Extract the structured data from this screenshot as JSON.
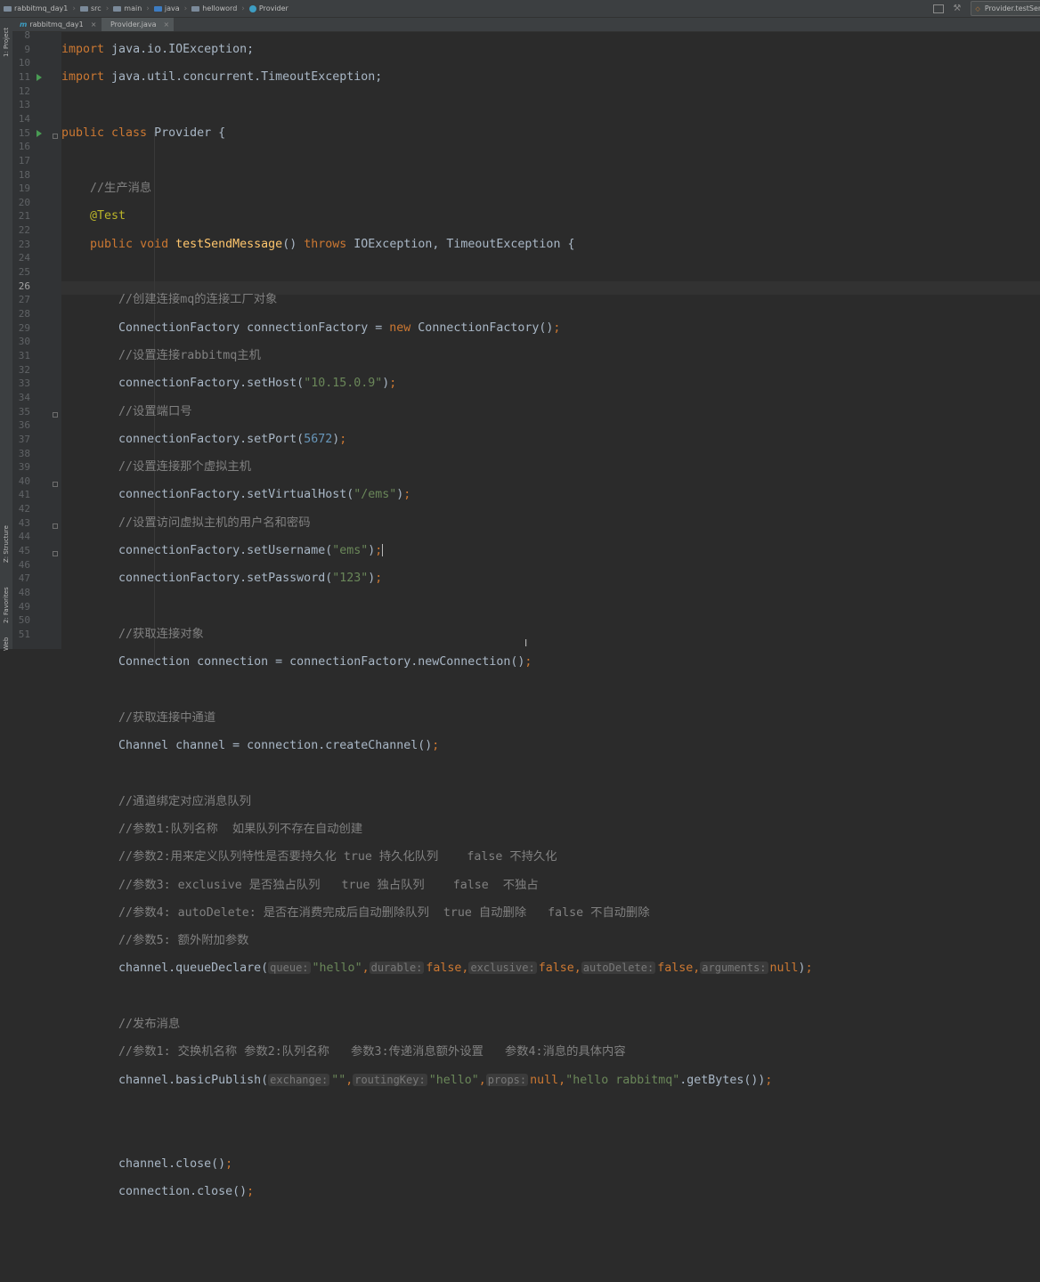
{
  "breadcrumbs": [
    "rabbitmq_day1",
    "src",
    "main",
    "java",
    "helloword",
    "Provider"
  ],
  "run_config": "Provider.testSen",
  "tabs": [
    {
      "label": "rabbitmq_day1",
      "active": false
    },
    {
      "label": "Provider.java",
      "active": true
    }
  ],
  "side_tabs": [
    "1: Project",
    "Z: Structure",
    "2: Favorites",
    "Web"
  ],
  "editor": {
    "current_line": 26,
    "line_numbers": [
      "8",
      "9",
      "10",
      "11",
      "12",
      "13",
      "14",
      "15",
      "16",
      "17",
      "18",
      "19",
      "20",
      "21",
      "22",
      "23",
      "24",
      "25",
      "26",
      "27",
      "28",
      "29",
      "30",
      "31",
      "32",
      "33",
      "34",
      "35",
      "36",
      "37",
      "38",
      "39",
      "40",
      "41",
      "42",
      "43",
      "44",
      "45",
      "46",
      "47",
      "48",
      "49",
      "50",
      "51"
    ],
    "code": {
      "l8_kw": "import",
      "l8_rest": " java.io.IOException;",
      "l9_kw": "import",
      "l9_rest": " java.util.concurrent.TimeoutException;",
      "l11_kw": "public class",
      "l11_rest": " Provider {",
      "l13": "//生产消息",
      "l14": "@Test",
      "l15_kw": "public void",
      "l15_fn": "testSendMessage",
      "l15_mid": "() ",
      "l15_throws": "throws",
      "l15_rest": " IOException, TimeoutException {",
      "l17": "//创建连接mq的连接工厂对象",
      "l18_a": "ConnectionFactory connectionFactory = ",
      "l18_new": "new",
      "l18_b": " ConnectionFactory()",
      "l19": "//设置连接rabbitmq主机",
      "l20_a": "connectionFactory.setHost(",
      "l20_s": "\"10.15.0.9\"",
      "l21": "//设置端口号",
      "l22_a": "connectionFactory.setPort(",
      "l22_n": "5672",
      "l23": "//设置连接那个虚拟主机",
      "l24_a": "connectionFactory.setVirtualHost(",
      "l24_s": "\"/ems\"",
      "l25": "//设置访问虚拟主机的用户名和密码",
      "l26_a": "connectionFactory.setUsername(",
      "l26_s": "\"ems\"",
      "l27_a": "connectionFactory.setPassword(",
      "l27_s": "\"123\"",
      "l29": "//获取连接对象",
      "l30": "Connection connection = connectionFactory.newConnection()",
      "l32": "//获取连接中通道",
      "l33": "Channel channel = connection.createChannel()",
      "l35": "//通道绑定对应消息队列",
      "l36": "//参数1:队列名称  如果队列不存在自动创建",
      "l37": "//参数2:用来定义队列特性是否要持久化 true 持久化队列    false 不持久化",
      "l38": "//参数3: exclusive 是否独占队列   true 独占队列    false  不独占",
      "l39": "//参数4: autoDelete: 是否在消费完成后自动删除队列  true 自动删除   false 不自动删除",
      "l40": "//参数5: 额外附加参数",
      "l41_a": "channel.queueDeclare(",
      "l41_h1": "queue:",
      "l41_s1": "\"hello\"",
      "l41_h2": "durable:",
      "l41_k2": "false",
      "l41_h3": "exclusive:",
      "l41_k3": "false",
      "l41_h4": "autoDelete:",
      "l41_k4": "false",
      "l41_h5": "arguments:",
      "l41_k5": "null",
      "l43": "//发布消息",
      "l44": "//参数1: 交换机名称 参数2:队列名称   参数3:传递消息额外设置   参数4:消息的具体内容",
      "l45_a": "channel.basicPublish(",
      "l45_h1": "exchange:",
      "l45_s1": "\"\"",
      "l45_h2": "routingKey:",
      "l45_s2": "\"hello\"",
      "l45_h3": "props:",
      "l45_k3": "null",
      "l45_s4": "\"hello rabbitmq\"",
      "l45_b": ".getBytes())",
      "l48": "channel.close()",
      "l49": "connection.close()"
    }
  }
}
